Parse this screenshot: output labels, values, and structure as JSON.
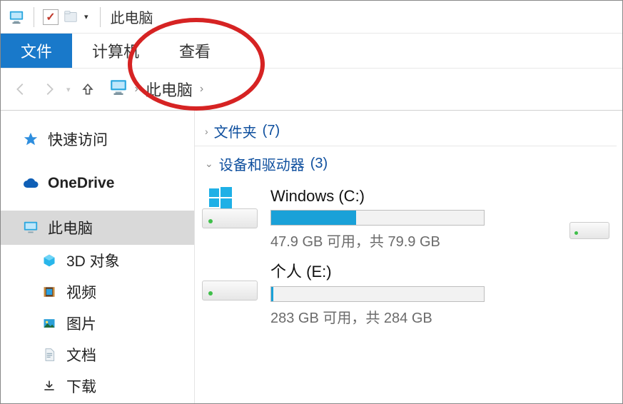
{
  "titlebar": {
    "title": "此电脑"
  },
  "menubar": {
    "file": "文件",
    "computer": "计算机",
    "view": "查看"
  },
  "breadcrumb": {
    "current": "此电脑"
  },
  "sidebar": {
    "quick_access": "快速访问",
    "onedrive": "OneDrive",
    "this_pc": "此电脑",
    "children": {
      "objects3d": "3D 对象",
      "videos": "视频",
      "pictures": "图片",
      "documents": "文档",
      "downloads": "下载"
    }
  },
  "main": {
    "folders_group": {
      "label": "文件夹",
      "count": "(7)"
    },
    "drives_group": {
      "label": "设备和驱动器",
      "count": "(3)"
    },
    "drives": [
      {
        "name": "Windows (C:)",
        "stat": "47.9 GB 可用，共 79.9 GB",
        "fill_pct": 40
      },
      {
        "name": "个人 (E:)",
        "stat": "283 GB 可用，共 284 GB",
        "fill_pct": 1
      }
    ]
  }
}
